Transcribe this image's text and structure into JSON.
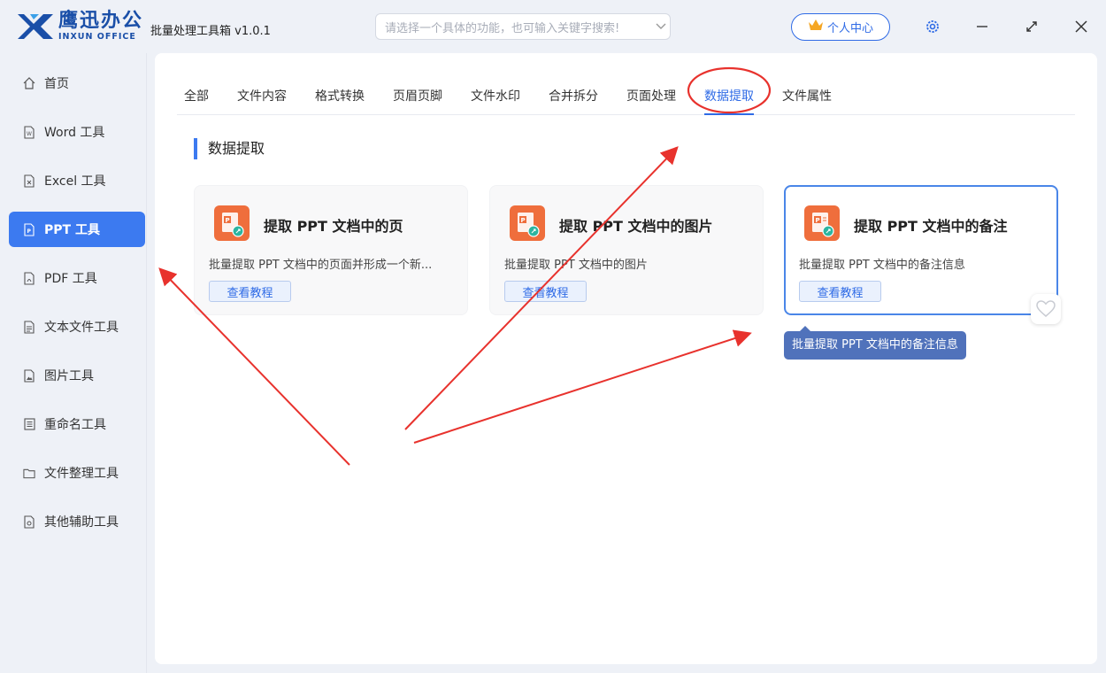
{
  "titlebar": {
    "logo_cn": "鹰迅办公",
    "logo_en": "INXUN OFFICE",
    "app_title": "批量处理工具箱 v1.0.1",
    "search_placeholder": "请选择一个具体的功能，也可输入关键字搜索!",
    "user_center": "个人中心",
    "brand_color": "#1a4fa8",
    "icons": [
      "settings-icon",
      "minimize-icon",
      "maximize-icon",
      "close-icon"
    ]
  },
  "sidebar": {
    "items": [
      {
        "label": "首页",
        "icon": "home-icon"
      },
      {
        "label": "Word 工具",
        "icon": "word-file-icon"
      },
      {
        "label": "Excel 工具",
        "icon": "excel-file-icon"
      },
      {
        "label": "PPT 工具",
        "icon": "ppt-file-icon",
        "active": true
      },
      {
        "label": "PDF 工具",
        "icon": "pdf-file-icon"
      },
      {
        "label": "文本文件工具",
        "icon": "text-file-icon"
      },
      {
        "label": "图片工具",
        "icon": "image-file-icon"
      },
      {
        "label": "重命名工具",
        "icon": "rename-icon"
      },
      {
        "label": "文件整理工具",
        "icon": "folder-icon"
      },
      {
        "label": "其他辅助工具",
        "icon": "other-tools-icon"
      }
    ],
    "active_color": "#3c7af0"
  },
  "tabs": [
    {
      "label": "全部"
    },
    {
      "label": "文件内容"
    },
    {
      "label": "格式转换"
    },
    {
      "label": "页眉页脚"
    },
    {
      "label": "文件水印"
    },
    {
      "label": "合并拆分"
    },
    {
      "label": "页面处理"
    },
    {
      "label": "数据提取",
      "active": true
    },
    {
      "label": "文件属性"
    }
  ],
  "section_title": "数据提取",
  "cards": [
    {
      "title": "提取 PPT 文档中的页",
      "desc": "批量提取 PPT 文档中的页面并形成一个新...",
      "button": "查看教程",
      "icon": "ppt-icon"
    },
    {
      "title": "提取 PPT 文档中的图片",
      "desc": "批量提取 PPT 文档中的图片",
      "button": "查看教程",
      "icon": "ppt-icon"
    },
    {
      "title": "提取 PPT 文档中的备注",
      "desc": "批量提取 PPT 文档中的备注信息",
      "button": "查看教程",
      "icon": "ppt-icon",
      "selected": true
    }
  ],
  "tooltip": "批量提取 PPT 文档中的备注信息",
  "annotation_color": "#e8322d",
  "icon_color": "#ef6e3c"
}
